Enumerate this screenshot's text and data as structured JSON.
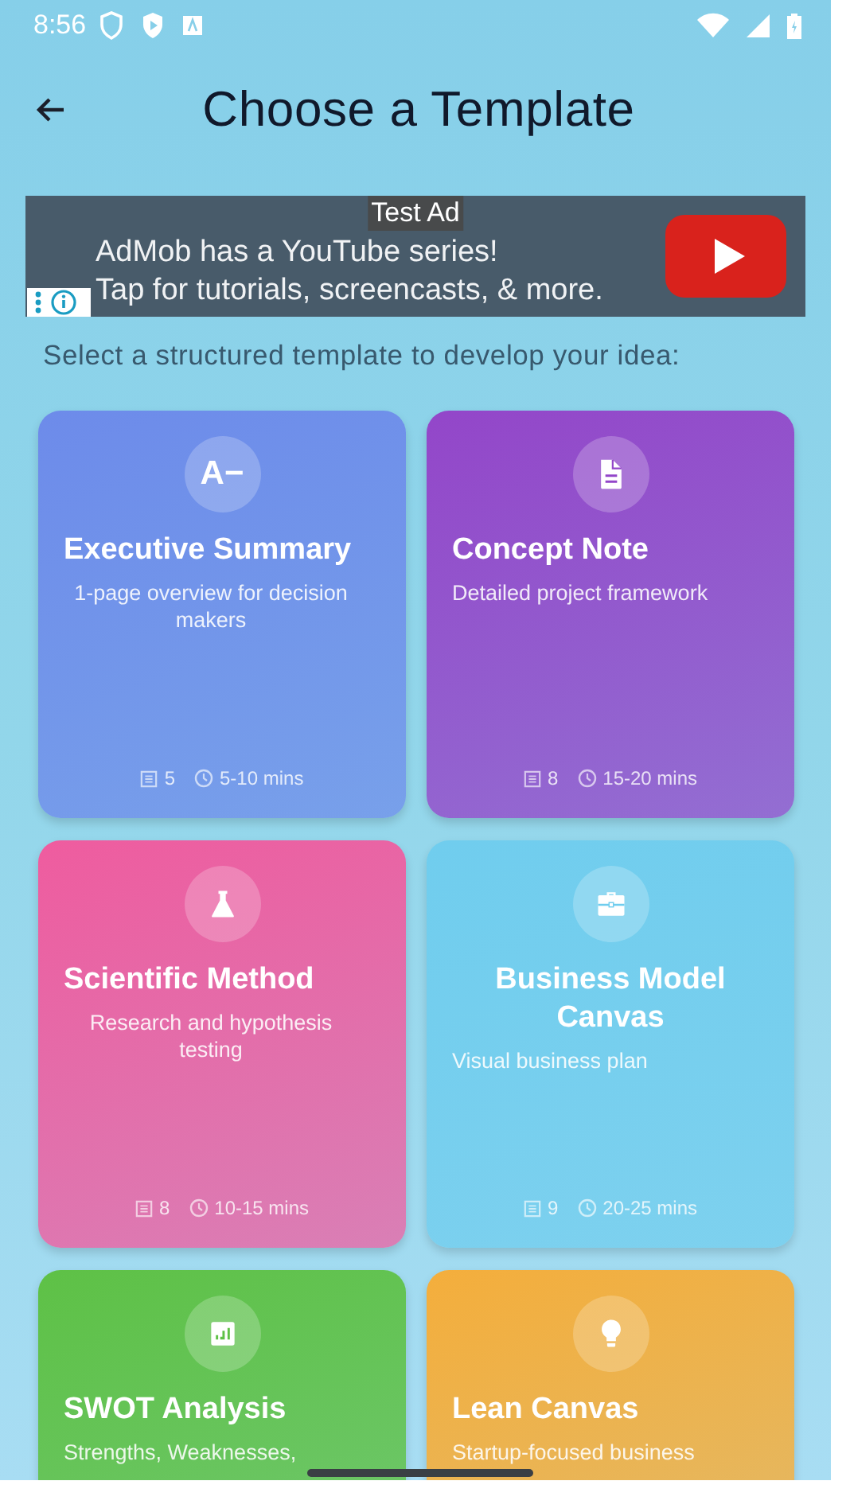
{
  "status_bar": {
    "time": "8:56"
  },
  "header": {
    "title": "Choose a Template"
  },
  "ad": {
    "badge": "Test Ad",
    "lines": [
      "AdMob has a YouTube series!",
      "Tap for tutorials, screencasts, & more."
    ]
  },
  "intro": "Select a structured template to develop your idea:",
  "templates": [
    {
      "title": "Executive Summary",
      "description": "1-page overview for decision makers",
      "kind": "letters",
      "icon_text": "A−",
      "sections": "5",
      "duration": "5-10 mins",
      "color": "#6d8bea"
    },
    {
      "title": "Concept Note",
      "description": "Detailed project framework",
      "kind": "document",
      "sections": "8",
      "duration": "15-20 mins",
      "color": "#9346c9"
    },
    {
      "title": "Scientific Method",
      "description": "Research and hypothesis testing",
      "kind": "flask",
      "sections": "8",
      "duration": "10-15 mins",
      "color": "#ef5c9f"
    },
    {
      "title": "Business Model Canvas",
      "description": "Visual business plan",
      "kind": "briefcase",
      "sections": "9",
      "duration": "20-25 mins",
      "color": "#70cdee"
    },
    {
      "title": "SWOT Analysis",
      "description": "Strengths, Weaknesses,",
      "kind": "chart",
      "color": "#5ec146"
    },
    {
      "title": "Lean Canvas",
      "description": "Startup-focused business",
      "kind": "bulb",
      "color": "#f4ae3c"
    }
  ]
}
